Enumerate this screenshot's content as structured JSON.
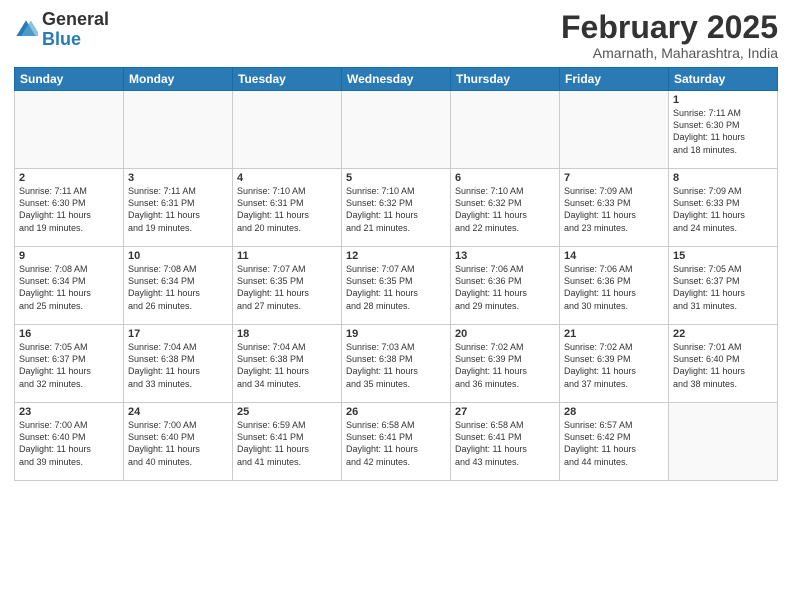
{
  "header": {
    "logo_general": "General",
    "logo_blue": "Blue",
    "month_title": "February 2025",
    "location": "Amarnath, Maharashtra, India"
  },
  "days_of_week": [
    "Sunday",
    "Monday",
    "Tuesday",
    "Wednesday",
    "Thursday",
    "Friday",
    "Saturday"
  ],
  "weeks": [
    [
      {
        "day": "",
        "info": ""
      },
      {
        "day": "",
        "info": ""
      },
      {
        "day": "",
        "info": ""
      },
      {
        "day": "",
        "info": ""
      },
      {
        "day": "",
        "info": ""
      },
      {
        "day": "",
        "info": ""
      },
      {
        "day": "1",
        "info": "Sunrise: 7:11 AM\nSunset: 6:30 PM\nDaylight: 11 hours\nand 18 minutes."
      }
    ],
    [
      {
        "day": "2",
        "info": "Sunrise: 7:11 AM\nSunset: 6:30 PM\nDaylight: 11 hours\nand 19 minutes."
      },
      {
        "day": "3",
        "info": "Sunrise: 7:11 AM\nSunset: 6:31 PM\nDaylight: 11 hours\nand 19 minutes."
      },
      {
        "day": "4",
        "info": "Sunrise: 7:10 AM\nSunset: 6:31 PM\nDaylight: 11 hours\nand 20 minutes."
      },
      {
        "day": "5",
        "info": "Sunrise: 7:10 AM\nSunset: 6:32 PM\nDaylight: 11 hours\nand 21 minutes."
      },
      {
        "day": "6",
        "info": "Sunrise: 7:10 AM\nSunset: 6:32 PM\nDaylight: 11 hours\nand 22 minutes."
      },
      {
        "day": "7",
        "info": "Sunrise: 7:09 AM\nSunset: 6:33 PM\nDaylight: 11 hours\nand 23 minutes."
      },
      {
        "day": "8",
        "info": "Sunrise: 7:09 AM\nSunset: 6:33 PM\nDaylight: 11 hours\nand 24 minutes."
      }
    ],
    [
      {
        "day": "9",
        "info": "Sunrise: 7:08 AM\nSunset: 6:34 PM\nDaylight: 11 hours\nand 25 minutes."
      },
      {
        "day": "10",
        "info": "Sunrise: 7:08 AM\nSunset: 6:34 PM\nDaylight: 11 hours\nand 26 minutes."
      },
      {
        "day": "11",
        "info": "Sunrise: 7:07 AM\nSunset: 6:35 PM\nDaylight: 11 hours\nand 27 minutes."
      },
      {
        "day": "12",
        "info": "Sunrise: 7:07 AM\nSunset: 6:35 PM\nDaylight: 11 hours\nand 28 minutes."
      },
      {
        "day": "13",
        "info": "Sunrise: 7:06 AM\nSunset: 6:36 PM\nDaylight: 11 hours\nand 29 minutes."
      },
      {
        "day": "14",
        "info": "Sunrise: 7:06 AM\nSunset: 6:36 PM\nDaylight: 11 hours\nand 30 minutes."
      },
      {
        "day": "15",
        "info": "Sunrise: 7:05 AM\nSunset: 6:37 PM\nDaylight: 11 hours\nand 31 minutes."
      }
    ],
    [
      {
        "day": "16",
        "info": "Sunrise: 7:05 AM\nSunset: 6:37 PM\nDaylight: 11 hours\nand 32 minutes."
      },
      {
        "day": "17",
        "info": "Sunrise: 7:04 AM\nSunset: 6:38 PM\nDaylight: 11 hours\nand 33 minutes."
      },
      {
        "day": "18",
        "info": "Sunrise: 7:04 AM\nSunset: 6:38 PM\nDaylight: 11 hours\nand 34 minutes."
      },
      {
        "day": "19",
        "info": "Sunrise: 7:03 AM\nSunset: 6:38 PM\nDaylight: 11 hours\nand 35 minutes."
      },
      {
        "day": "20",
        "info": "Sunrise: 7:02 AM\nSunset: 6:39 PM\nDaylight: 11 hours\nand 36 minutes."
      },
      {
        "day": "21",
        "info": "Sunrise: 7:02 AM\nSunset: 6:39 PM\nDaylight: 11 hours\nand 37 minutes."
      },
      {
        "day": "22",
        "info": "Sunrise: 7:01 AM\nSunset: 6:40 PM\nDaylight: 11 hours\nand 38 minutes."
      }
    ],
    [
      {
        "day": "23",
        "info": "Sunrise: 7:00 AM\nSunset: 6:40 PM\nDaylight: 11 hours\nand 39 minutes."
      },
      {
        "day": "24",
        "info": "Sunrise: 7:00 AM\nSunset: 6:40 PM\nDaylight: 11 hours\nand 40 minutes."
      },
      {
        "day": "25",
        "info": "Sunrise: 6:59 AM\nSunset: 6:41 PM\nDaylight: 11 hours\nand 41 minutes."
      },
      {
        "day": "26",
        "info": "Sunrise: 6:58 AM\nSunset: 6:41 PM\nDaylight: 11 hours\nand 42 minutes."
      },
      {
        "day": "27",
        "info": "Sunrise: 6:58 AM\nSunset: 6:41 PM\nDaylight: 11 hours\nand 43 minutes."
      },
      {
        "day": "28",
        "info": "Sunrise: 6:57 AM\nSunset: 6:42 PM\nDaylight: 11 hours\nand 44 minutes."
      },
      {
        "day": "",
        "info": ""
      }
    ]
  ]
}
